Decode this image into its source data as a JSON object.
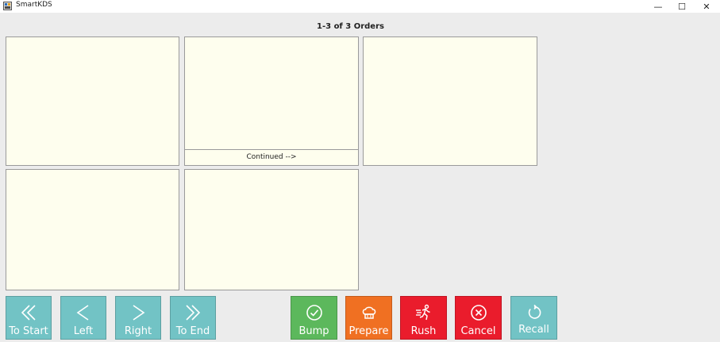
{
  "window": {
    "title": "SmartKDS",
    "minimize_glyph": "—",
    "maximize_glyph": "☐",
    "close_glyph": "✕"
  },
  "header": {
    "order_count": "1-3 of 3 Orders"
  },
  "panels": [
    {
      "id": 1,
      "footer": ""
    },
    {
      "id": 2,
      "footer": "Continued -->"
    },
    {
      "id": 3,
      "footer": ""
    },
    {
      "id": 4,
      "footer": ""
    },
    {
      "id": 5,
      "footer": ""
    }
  ],
  "nav_buttons": {
    "to_start": {
      "label": "To Start",
      "icon": "double-chevron-left-icon"
    },
    "left": {
      "label": "Left",
      "icon": "chevron-left-icon"
    },
    "right": {
      "label": "Right",
      "icon": "chevron-right-icon"
    },
    "to_end": {
      "label": "To End",
      "icon": "double-chevron-right-icon"
    }
  },
  "action_buttons": {
    "bump": {
      "label": "Bump",
      "icon": "check-circle-icon",
      "color": "#5cb85c"
    },
    "prepare": {
      "label": "Prepare",
      "icon": "chef-hat-icon",
      "color": "#f07022"
    },
    "rush": {
      "label": "Rush",
      "icon": "running-person-icon",
      "color": "#ea1c2c"
    },
    "cancel": {
      "label": "Cancel",
      "icon": "x-circle-icon",
      "color": "#ea1c2c"
    },
    "recall": {
      "label": "Recall",
      "icon": "refresh-icon",
      "color": "#72c3c5"
    }
  },
  "colors": {
    "panel_background": "#fefeee",
    "nav_button": "#72c3c5",
    "window_background": "#ececec"
  }
}
